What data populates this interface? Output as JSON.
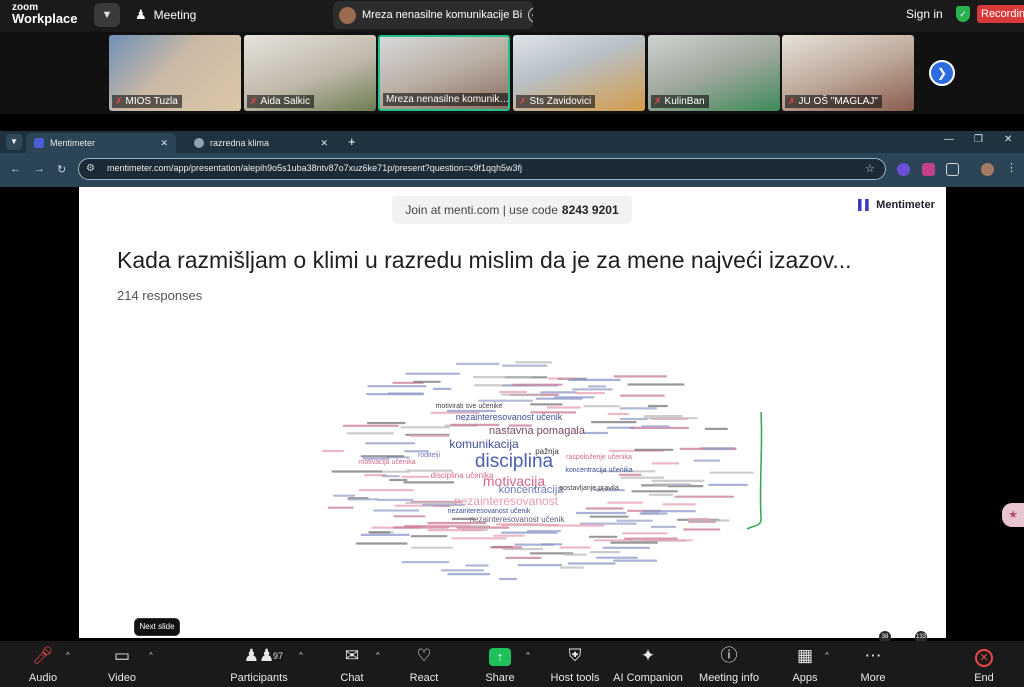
{
  "zoom": {
    "logo_line1": "zoom",
    "logo_line2": "Workplace",
    "meeting_label": "Meeting",
    "active_speaker": "Mreza nenasilne komunikacije Bi",
    "sign_in": "Sign in",
    "recording": "Recording"
  },
  "participants": [
    {
      "name": "MIOS Tuzla"
    },
    {
      "name": "Aida Salkic"
    },
    {
      "name": "Mreza nenasilne komunik…"
    },
    {
      "name": "Sts Zavidovici"
    },
    {
      "name": "KulinBan"
    },
    {
      "name": "JU OŠ \"MAGLAJ\""
    }
  ],
  "browser": {
    "tabs": [
      {
        "label": "Mentimeter"
      },
      {
        "label": "razredna klima"
      }
    ],
    "url": "mentimeter.com/app/presentation/alepih9o5s1uba38ntv87o7xuz6ke71p/present?question=x9f1qqh5w3fj"
  },
  "slide": {
    "join_text": "Join at menti.com | use code",
    "join_code": "8243 9201",
    "brand": "Mentimeter",
    "question": "Kada razmišljam o klimi u razredu mislim da je za mene najveći izazov...",
    "responses": "214 responses",
    "counter_a": "38",
    "counter_b": "133",
    "cloud_words": [
      {
        "text": "disciplina",
        "size": 19,
        "color": "#4b5fb0"
      },
      {
        "text": "motivacija",
        "size": 14,
        "color": "#d7678e"
      },
      {
        "text": "komunikacija",
        "size": 12,
        "color": "#3d4f9a"
      },
      {
        "text": "nezainteresovanost",
        "size": 12,
        "color": "#e89bb3"
      },
      {
        "text": "nastavna pomagala",
        "size": 11,
        "color": "#7a4a63"
      },
      {
        "text": "koncentracija",
        "size": 11,
        "color": "#6c7ab8"
      },
      {
        "text": "nezainteresovanost učenik",
        "size": 9,
        "color": "#3d4f9a"
      },
      {
        "text": "nezainteresovanost učenik",
        "size": 8,
        "color": "#5c5c7a"
      },
      {
        "text": "disciplina učenika",
        "size": 8,
        "color": "#d7678e"
      },
      {
        "text": "pažnja",
        "size": 8,
        "color": "#3a3a3a"
      },
      {
        "text": "motivacija učenika",
        "size": 7,
        "color": "#d7678e"
      },
      {
        "text": "motivirati sve učenike",
        "size": 7,
        "color": "#444"
      },
      {
        "text": "roditelji",
        "size": 7,
        "color": "#6c7ab8"
      },
      {
        "text": "raspoloženje učenika",
        "size": 7,
        "color": "#d7678e"
      },
      {
        "text": "koncentracija učenika",
        "size": 7,
        "color": "#3d4f9a"
      },
      {
        "text": "postavljanje pravila",
        "size": 7,
        "color": "#444"
      },
      {
        "text": "nezainteresovanost učenik",
        "size": 7,
        "color": "#3d4f9a"
      }
    ]
  },
  "tooltip": "Next slide",
  "toolbar": {
    "audio": "Audio",
    "video": "Video",
    "participants": "Participants",
    "participant_count": "97",
    "chat": "Chat",
    "react": "React",
    "share": "Share",
    "host_tools": "Host tools",
    "ai_companion": "AI Companion",
    "meeting_info": "Meeting info",
    "apps": "Apps",
    "more": "More",
    "end": "End"
  }
}
